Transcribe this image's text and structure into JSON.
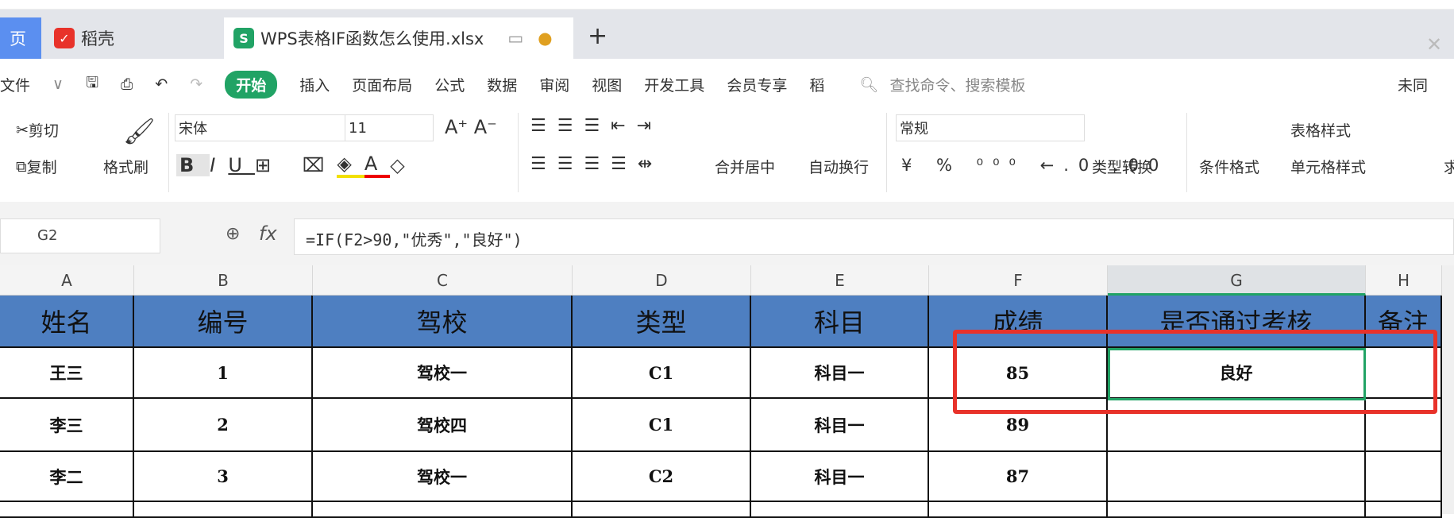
{
  "tabs": [
    {
      "label": "页"
    },
    {
      "label": "稻壳"
    },
    {
      "label": "WPS表格IF函数怎么使用.xlsx"
    }
  ],
  "menu": {
    "file": "文件",
    "items": [
      "开始",
      "插入",
      "页面布局",
      "公式",
      "数据",
      "审阅",
      "视图",
      "开发工具",
      "会员专享",
      "稻"
    ],
    "search": "查找命令、搜索模板",
    "sync": "未同"
  },
  "ribbon": {
    "cut": "剪切",
    "copy": "复制",
    "format_painter": "格式刷",
    "font": "宋体",
    "size": "11",
    "merge": "合并居中",
    "wrap": "自动换行",
    "number_format": "常规",
    "convert": "类型转换",
    "cond_format": "条件格式",
    "table_style": "表格样式",
    "cell_style": "单元格样式",
    "sum": "求"
  },
  "formula_bar": {
    "name_box": "G2",
    "fx": "fx",
    "formula": "=IF(F2>90,\"优秀\",\"良好\")"
  },
  "columns": [
    "A",
    "B",
    "C",
    "D",
    "E",
    "F",
    "G",
    "H"
  ],
  "header": [
    "姓名",
    "编号",
    "驾校",
    "类型",
    "科目",
    "成绩",
    "是否通过考核",
    "备注"
  ],
  "rows": [
    [
      "王三",
      "1",
      "驾校一",
      "C1",
      "科目一",
      "85",
      "良好",
      ""
    ],
    [
      "李三",
      "2",
      "驾校四",
      "C1",
      "科目一",
      "89",
      "",
      ""
    ],
    [
      "李二",
      "3",
      "驾校一",
      "C2",
      "科目一",
      "87",
      "",
      ""
    ]
  ],
  "colors": {
    "header_fill": "#4e7fc1",
    "accent": "#21a365",
    "highlight": "#e8322a"
  }
}
